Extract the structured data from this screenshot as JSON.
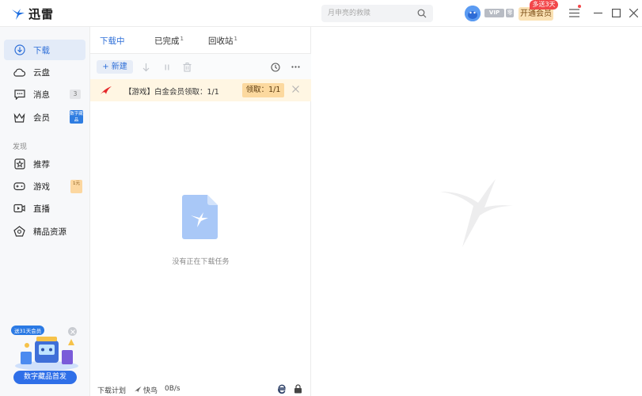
{
  "app": {
    "name": "迅雷"
  },
  "search": {
    "placeholder": "月申亮的救赎"
  },
  "header": {
    "vip_badge": "VIP",
    "level_badge": "零",
    "open_vip_label": "开通会员",
    "promo_bubble": "多送3天"
  },
  "sidebar": {
    "items": [
      {
        "label": "下载",
        "icon": "download-icon"
      },
      {
        "label": "云盘",
        "icon": "cloud-icon"
      },
      {
        "label": "消息",
        "icon": "message-icon",
        "count": "3"
      },
      {
        "label": "会员",
        "icon": "crown-icon",
        "tag": "数字藏品"
      }
    ],
    "section_label": "发现",
    "discover_items": [
      {
        "label": "推荐",
        "icon": "star-icon"
      },
      {
        "label": "游戏",
        "icon": "gamepad-icon",
        "tag": "1元"
      },
      {
        "label": "直播",
        "icon": "live-icon"
      },
      {
        "label": "精品资源",
        "icon": "gem-icon"
      }
    ],
    "promo": {
      "tag": "送31天会员",
      "button": "数字藏品首发"
    }
  },
  "tabs": [
    {
      "label": "下载中"
    },
    {
      "label": "已完成",
      "count": "1"
    },
    {
      "label": "回收站",
      "count": "1"
    }
  ],
  "toolbar": {
    "new_label": "+ 新建"
  },
  "banner": {
    "text": "【游戏】白金会员领取：1/1",
    "button": "领取：1/1"
  },
  "empty_state": {
    "text": "没有正在下载任务"
  },
  "statusbar": {
    "plan": "下载计划",
    "speed_mode": "快鸟",
    "speed": "0B/s"
  },
  "colors": {
    "accent": "#2e6fd8",
    "banner_bg": "#fff6e3",
    "vip_gold": "#fbe2b5"
  }
}
